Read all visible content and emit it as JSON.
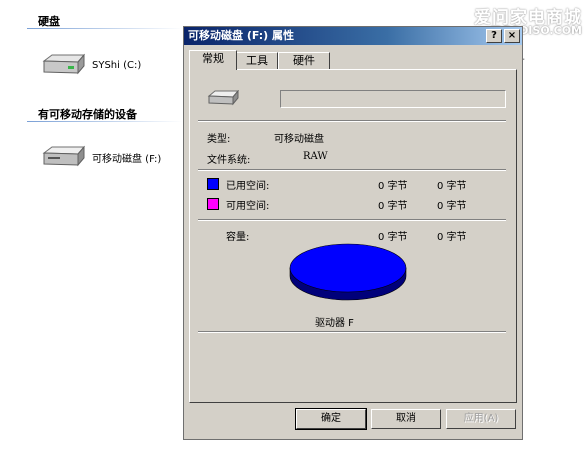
{
  "explorer": {
    "hard_disks_heading": "硬盘",
    "removable_heading": "有可移动存储的设备",
    "drives": [
      {
        "label": "SYShi (C:)",
        "icon": "hard-drive-icon"
      },
      {
        "label": "可移动磁盘 (F:)",
        "icon": "removable-drive-icon"
      }
    ]
  },
  "watermark": {
    "line1": "爱问家电商城",
    "line2": "JDPAOISO.COM"
  },
  "dialog": {
    "title": "可移动磁盘 (F:) 属性",
    "title_buttons": [
      "?",
      "×"
    ],
    "tabs": [
      "常规",
      "工具",
      "硬件"
    ],
    "name_value": "",
    "type_label": "类型:",
    "type_value": "可移动磁盘",
    "fs_label": "文件系统:",
    "fs_value": "RAW",
    "used_label": "已用空间:",
    "used_bytes": "0 字节",
    "used_size": "0 字节",
    "free_label": "可用空间:",
    "free_bytes": "0 字节",
    "free_size": "0 字节",
    "capacity_label": "容量:",
    "capacity_bytes": "0 字节",
    "capacity_size": "0 字节",
    "drive_label": "驱动器 F",
    "used_color": "#0000ff",
    "free_color": "#ff00ff",
    "buttons": {
      "ok": "确定",
      "cancel": "取消",
      "apply": "应用(A)"
    }
  }
}
